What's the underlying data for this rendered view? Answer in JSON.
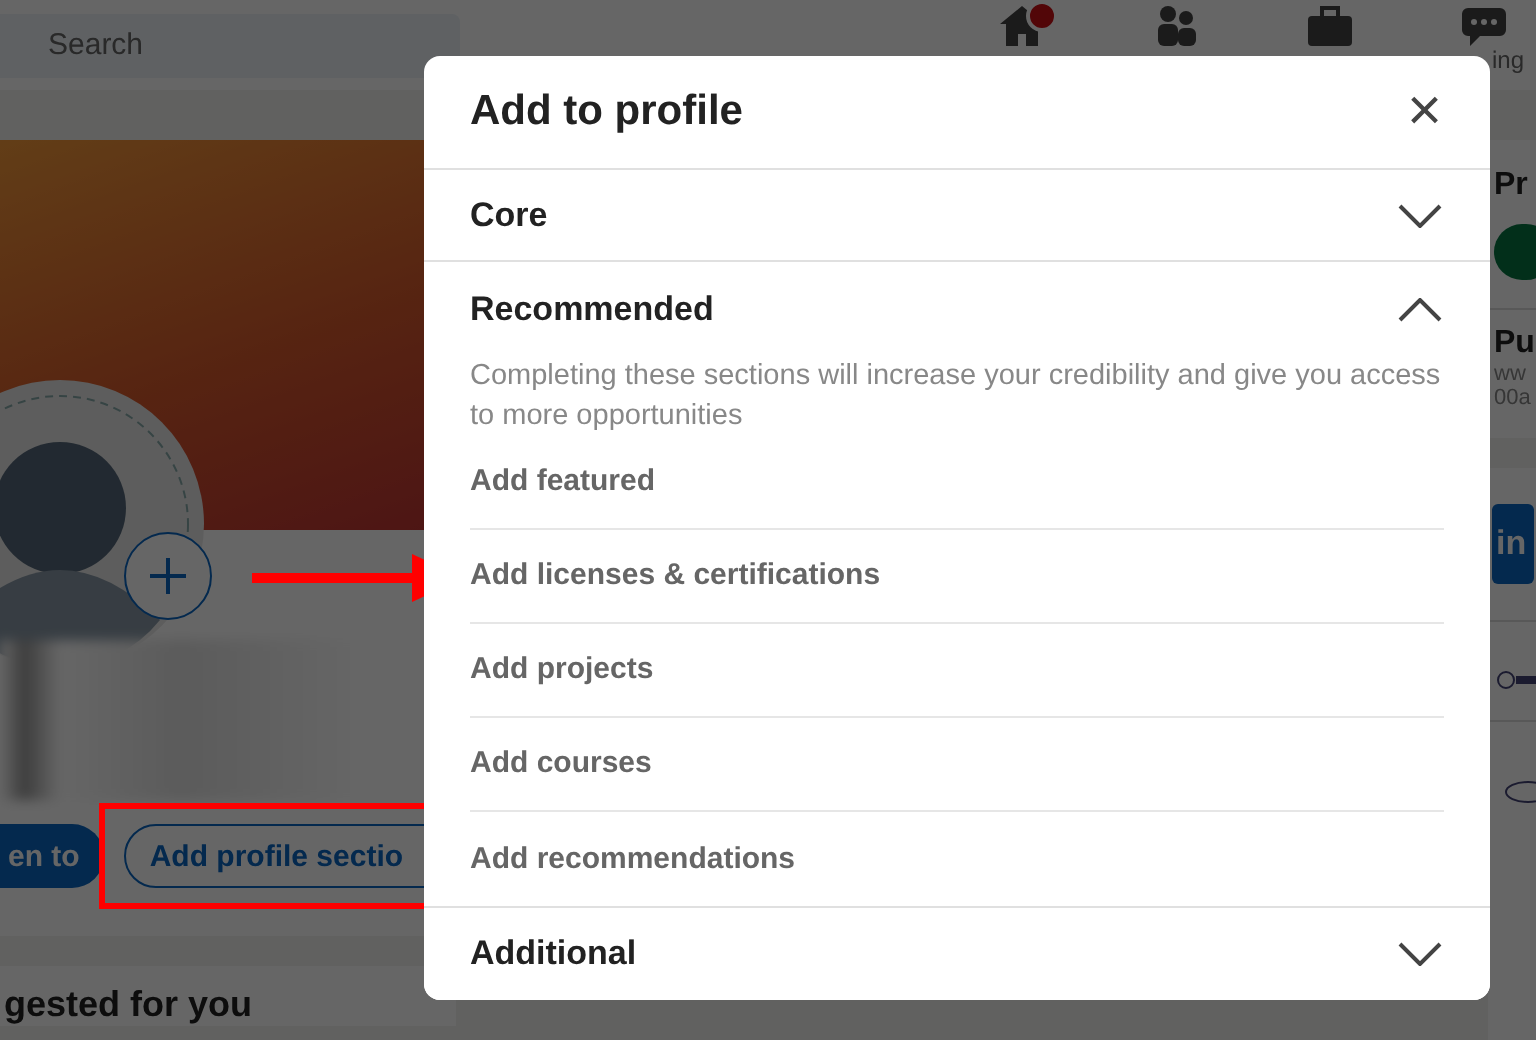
{
  "nav": {
    "search": {
      "placeholder": "Search"
    },
    "home_notification": true,
    "messaging_label": "ing"
  },
  "profile_card": {
    "buttons": [
      {
        "label": "en to",
        "kind": "primary"
      },
      {
        "label": "Add profile sectio",
        "kind": "outline"
      }
    ]
  },
  "suggested_heading": "gested for you",
  "right_column": {
    "card_1": {
      "heading_1": "Pr",
      "heading_2": "Pu",
      "line_1": "ww",
      "line_2": "00a"
    },
    "logo_text": "in"
  },
  "modal": {
    "title": "Add to profile",
    "close": "×",
    "sections": [
      {
        "title": "Core",
        "expanded": false
      },
      {
        "title": "Recommended",
        "expanded": true,
        "description": "Completing these sections will increase your credibility and give you access to more opportunities",
        "items": [
          "Add featured",
          "Add licenses & certifications",
          "Add projects",
          "Add courses",
          "Add recommendations"
        ]
      },
      {
        "title": "Additional",
        "expanded": false
      }
    ]
  }
}
